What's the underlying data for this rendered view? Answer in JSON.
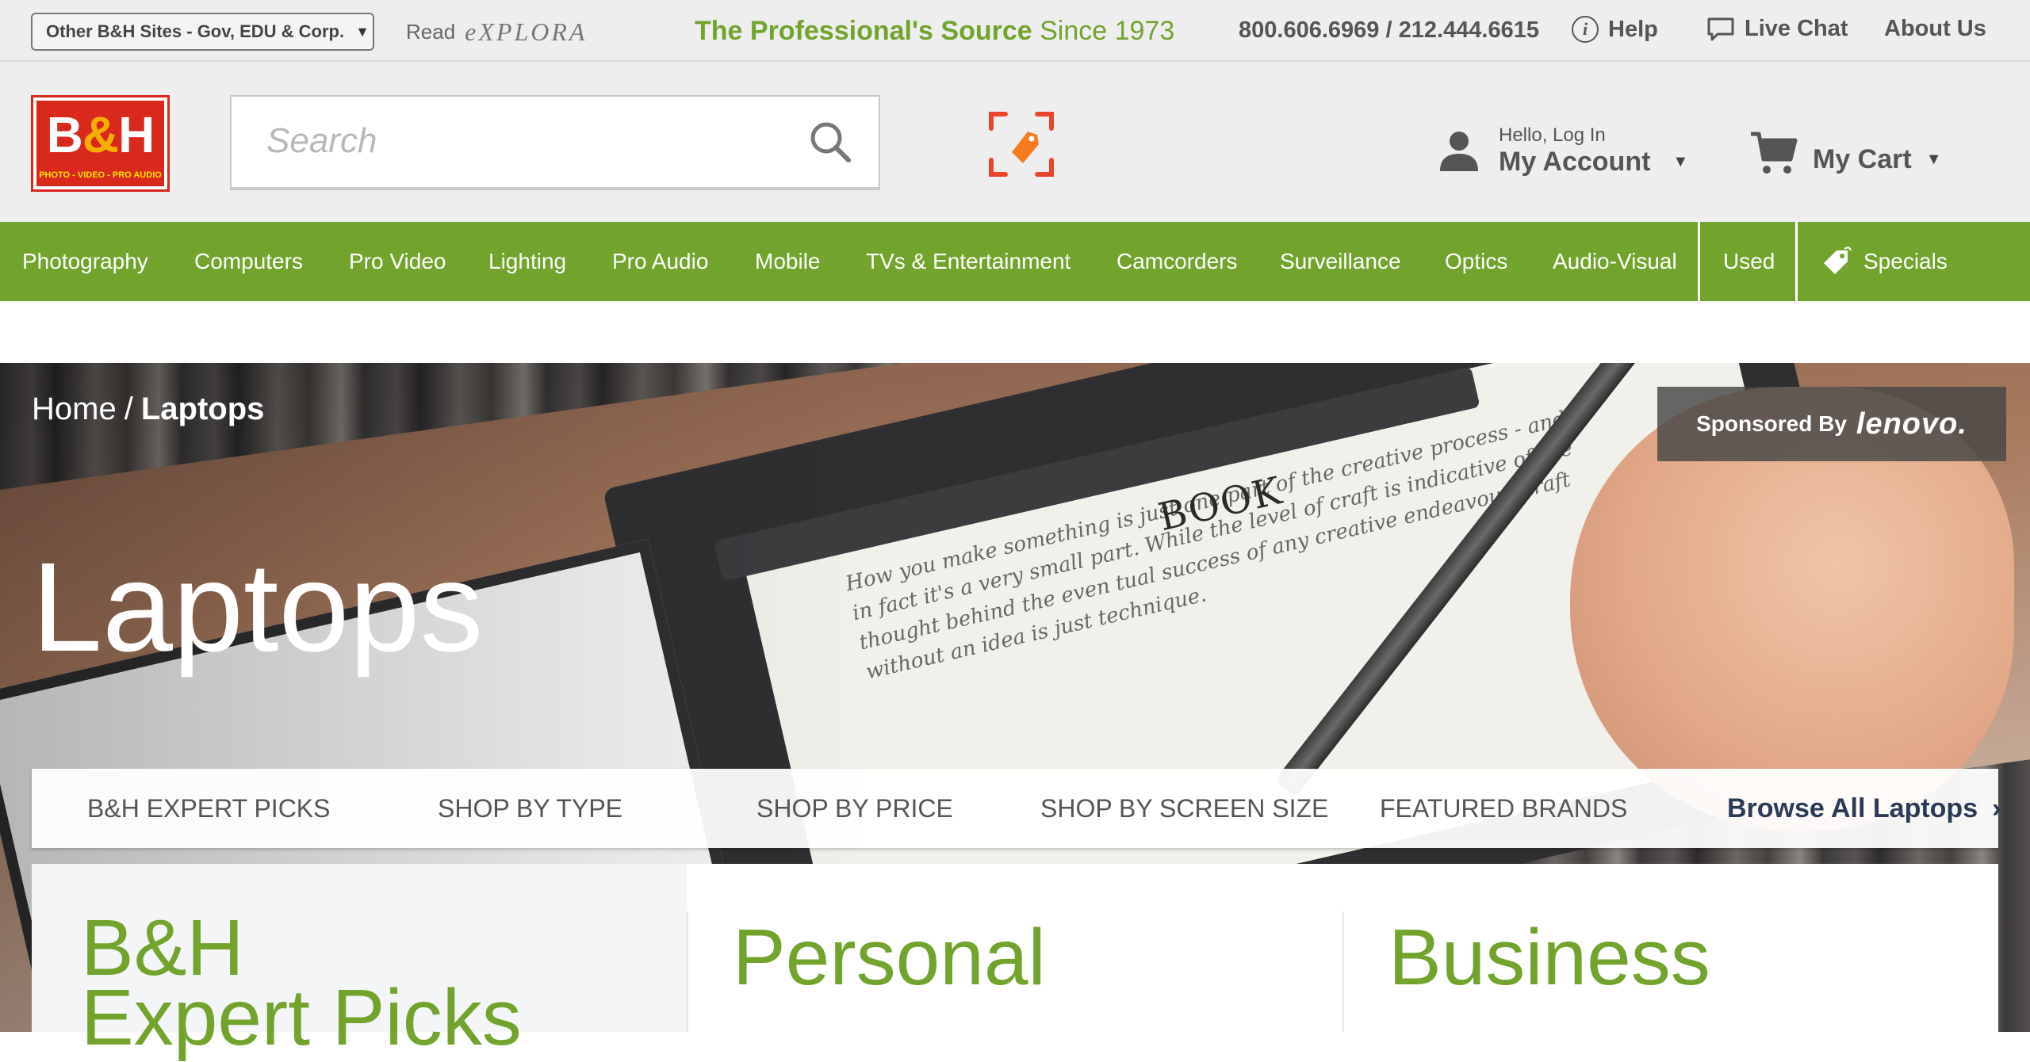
{
  "util_bar": {
    "other_sites": "Other B&H Sites - Gov, EDU & Corp.",
    "read_label": "Read",
    "explora": "eXPLORA",
    "tagline_bold": "The Professional's Source",
    "tagline_rest": " Since 1973",
    "phone": "800.606.6969 / 212.444.6615",
    "help": "Help",
    "live_chat": "Live Chat",
    "about_us": "About Us"
  },
  "header": {
    "logo_text_b": "B",
    "logo_text_amp": "&",
    "logo_text_h": "H",
    "logo_sub": "PHOTO - VIDEO - PRO AUDIO",
    "search_placeholder": "Search",
    "account_hello": "Hello, Log In",
    "account_label": "My Account",
    "cart_label": "My Cart"
  },
  "main_nav": {
    "items": [
      "Photography",
      "Computers",
      "Pro Video",
      "Lighting",
      "Pro Audio",
      "Mobile",
      "TVs & Entertainment",
      "Camcorders",
      "Surveillance",
      "Optics",
      "Audio-Visual"
    ],
    "used": "Used",
    "specials": "Specials"
  },
  "hero": {
    "breadcrumb_home": "Home",
    "breadcrumb_sep": "/",
    "breadcrumb_current": "Laptops",
    "title": "Laptops",
    "sponsored_label": "Sponsored By",
    "sponsor_brand": "lenovo.",
    "book_label": "BOOK",
    "paper_text": "How you make something is just one part of the creative process - and in fact it's a very small part. While the level of craft is indicative of the thought behind the even tual success of any creative endeavour, craft without an idea is just technique."
  },
  "sub_nav": {
    "tabs": [
      "B&H EXPERT PICKS",
      "SHOP BY TYPE",
      "SHOP BY PRICE",
      "SHOP BY SCREEN SIZE",
      "FEATURED BRANDS"
    ],
    "browse_all": "Browse All Laptops"
  },
  "cards": {
    "expert_title_line1": "B&H",
    "expert_title_line2": "Expert Picks",
    "personal_title": "Personal",
    "business_title": "Business"
  },
  "colors": {
    "brand_green": "#72a32d",
    "brand_red": "#d9281c",
    "deal_orange": "#f47b20"
  },
  "icons": {
    "info": "info-circle-icon",
    "chat": "speech-bubble-icon",
    "search": "magnifier-icon",
    "deal": "price-tag-scan-icon",
    "account": "user-silhouette-icon",
    "cart": "shopping-cart-icon",
    "specials": "tag-icon"
  }
}
